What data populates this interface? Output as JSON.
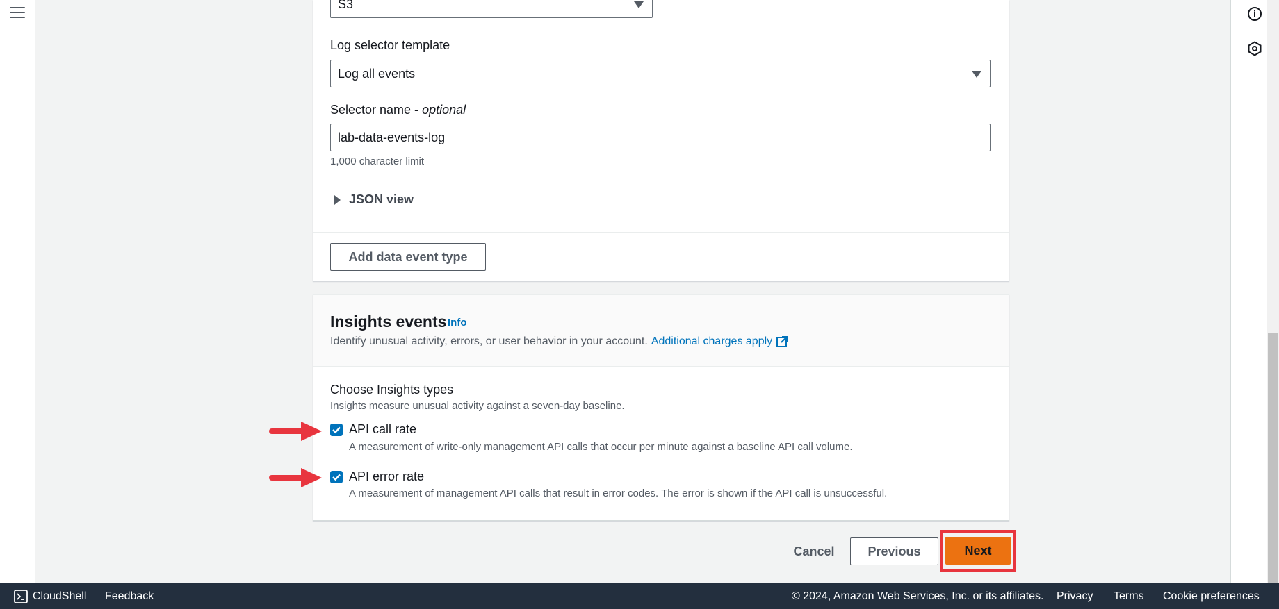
{
  "data_events": {
    "resource_type_value": "S3",
    "log_selector_label": "Log selector template",
    "log_selector_value": "Log all events",
    "selector_name_label": "Selector name - ",
    "selector_name_optional": "optional",
    "selector_name_value": "lab-data-events-log",
    "character_limit_hint": "1,000 character limit",
    "json_view_label": "JSON view",
    "add_button_label": "Add data event type"
  },
  "insights": {
    "title": "Insights events",
    "info_label": "Info",
    "description": "Identify unusual activity, errors, or user behavior in your account.",
    "charges_link": "Additional charges apply",
    "types_title": "Choose Insights types",
    "types_description": "Insights measure unusual activity against a seven-day baseline.",
    "options": [
      {
        "label": "API call rate",
        "description": "A measurement of write-only management API calls that occur per minute against a baseline API call volume.",
        "checked": true
      },
      {
        "label": "API error rate",
        "description": "A measurement of management API calls that result in error codes. The error is shown if the API call is unsuccessful.",
        "checked": true
      }
    ]
  },
  "actions": {
    "cancel_label": "Cancel",
    "previous_label": "Previous",
    "next_label": "Next"
  },
  "footer": {
    "cloudshell_label": "CloudShell",
    "feedback_label": "Feedback",
    "copyright": "© 2024, Amazon Web Services, Inc. or its affiliates.",
    "privacy_label": "Privacy",
    "terms_label": "Terms",
    "cookie_label": "Cookie preferences"
  },
  "colors": {
    "primary_button": "#ec7211",
    "link": "#0073bb",
    "checkbox": "#0073bb",
    "annotation": "#e8353e",
    "footer_bg": "#232f3e"
  },
  "icons": [
    "menu-icon",
    "info-icon",
    "settings-hexagon-icon",
    "external-link-icon",
    "terminal-icon",
    "caret-right-icon",
    "caret-down-icon",
    "checkmark-icon",
    "arrow-annotation"
  ]
}
